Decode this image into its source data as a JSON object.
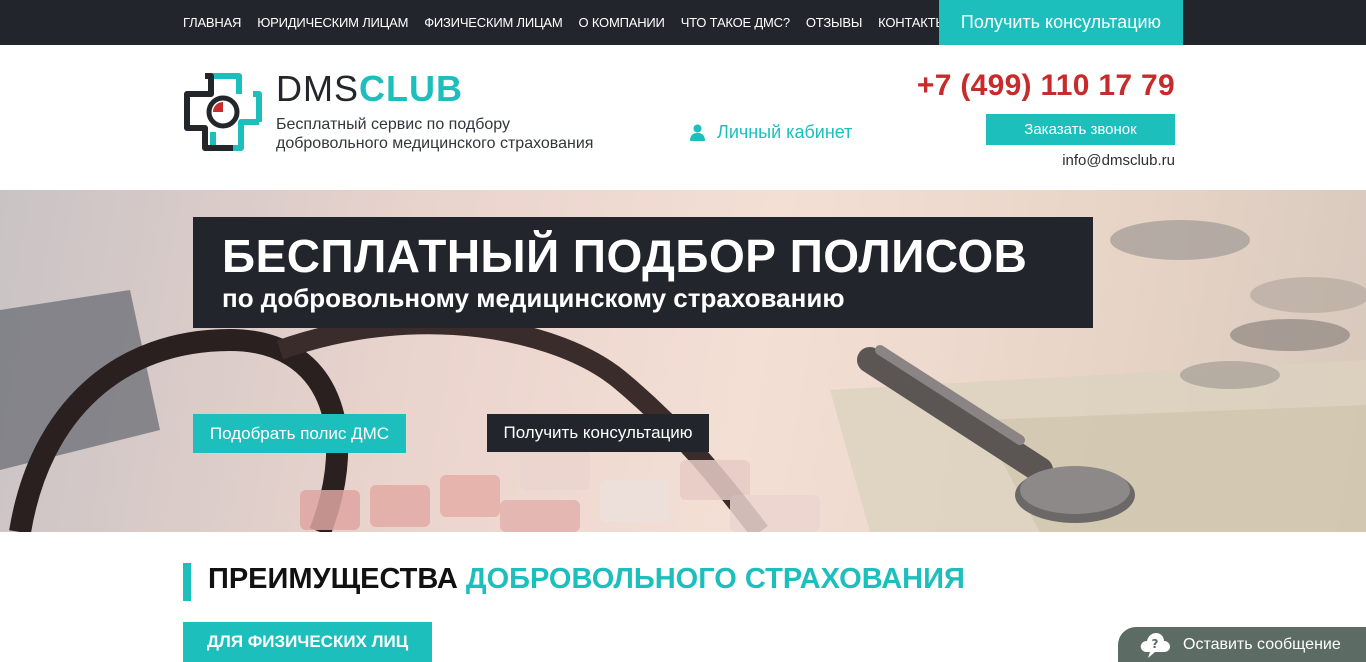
{
  "topnav": {
    "items": [
      "ГЛАВНАЯ",
      "ЮРИДИЧЕСКИМ ЛИЦАМ",
      "ФИЗИЧЕСКИМ ЛИЦАМ",
      "О КОМПАНИИ",
      "ЧТО ТАКОЕ ДМС?",
      "ОТЗЫВЫ",
      "КОНТАКТЫ"
    ],
    "cta": "Получить консультацию"
  },
  "header": {
    "logo_part1": "DMS",
    "logo_part2": "CLUB",
    "tagline_line1": "Бесплатный сервис по подбору",
    "tagline_line2": "добровольного медицинского страхования",
    "cabinet": "Личный кабинет",
    "phone": "+7 (499) 110 17 79",
    "callback": "Заказать звонок",
    "email": "info@dmsclub.ru"
  },
  "hero": {
    "title": "БЕСПЛАТНЫЙ ПОДБОР ПОЛИСОВ",
    "subtitle": "по добровольному медицинскому страхованию",
    "btn_pick": "Подобрать полис ДМС",
    "btn_consult": "Получить консультацию"
  },
  "advantages": {
    "title_dark": "ПРЕИМУЩЕСТВА",
    "title_teal": "ДОБРОВОЛЬНОГО СТРАХОВАНИЯ",
    "tab_physical": "ДЛЯ ФИЗИЧЕСКИХ ЛИЦ"
  },
  "chat": {
    "label": "Оставить сообщение"
  },
  "colors": {
    "accent": "#1dbfbc",
    "dark": "#22252b",
    "phone": "#c62c2c",
    "chat": "#5c6b64"
  },
  "icons": [
    "logo-cross-icon",
    "user-icon",
    "chat-cloud-icon"
  ]
}
